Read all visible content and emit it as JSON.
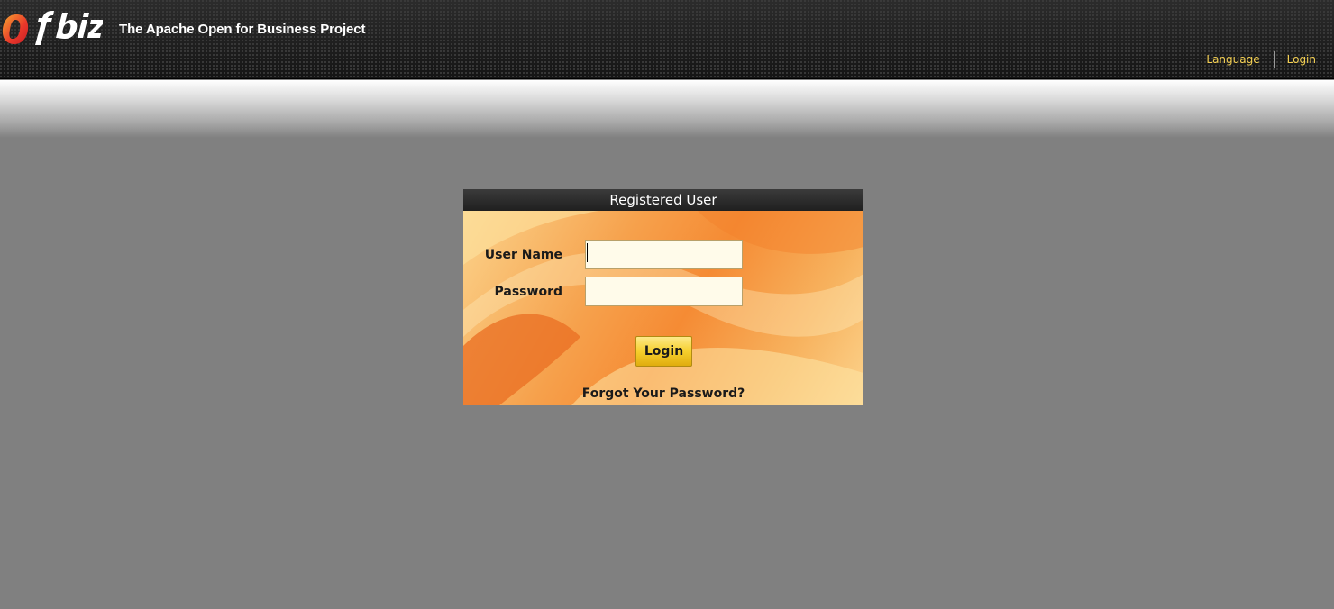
{
  "header": {
    "logo_text": "Ofbiz",
    "tagline": "The Apache Open for Business Project",
    "nav": {
      "language": "Language",
      "login": "Login"
    }
  },
  "login_form": {
    "title": "Registered User",
    "username_label": "User Name",
    "username_value": "",
    "password_label": "Password",
    "password_value": "",
    "submit_label": "Login",
    "forgot_link": "Forgot Your Password?"
  },
  "colors": {
    "page_background": "#808080",
    "header_background": "#1e1e1e",
    "nav_link": "#f3cf52",
    "form_orange": "#f58b34",
    "button_yellow": "#f6cf2d"
  }
}
